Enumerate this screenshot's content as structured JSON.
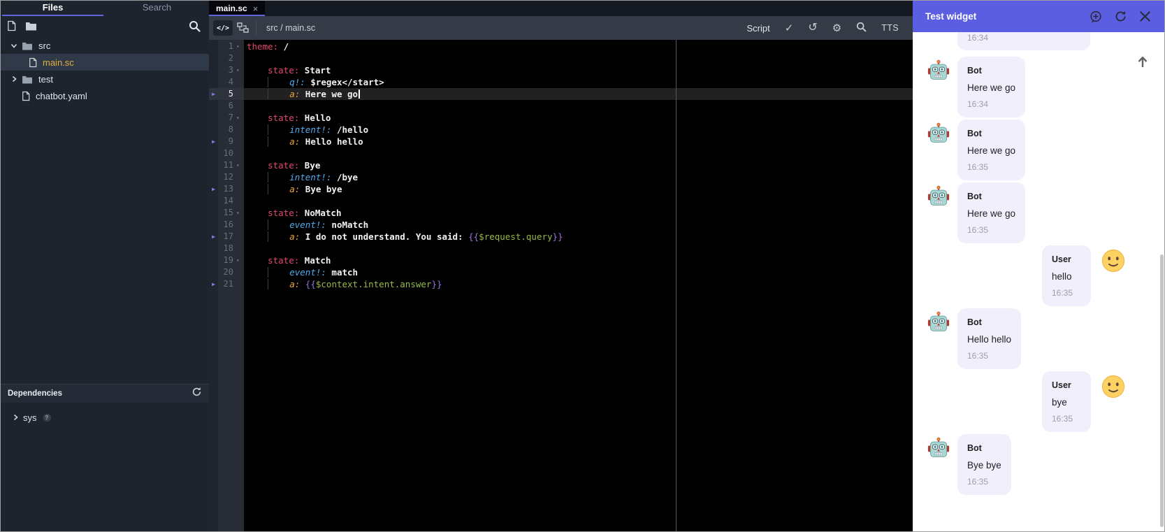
{
  "colors": {
    "accent": "#5f66e0",
    "chat-header": "#5b5ee1",
    "bubble": "#f1effb",
    "file-selected": "#e2b13c",
    "syn-key": "#e5486e",
    "syn-val": "#f2f2f2",
    "syn-q": "#53aef2",
    "syn-a": "#e8a33d",
    "syn-brace": "#9b6fe0",
    "syn-var": "#9aba46",
    "play": "#7b82e8"
  },
  "sidebar": {
    "tabs": [
      {
        "label": "Files",
        "active": true
      },
      {
        "label": "Search",
        "active": false
      }
    ],
    "tree": [
      {
        "kind": "folder",
        "label": "src",
        "expanded": true,
        "indent": 0,
        "selected": false
      },
      {
        "kind": "file",
        "label": "main.sc",
        "indent": 1,
        "selected": true
      },
      {
        "kind": "folder",
        "label": "test",
        "expanded": false,
        "indent": 0,
        "selected": false
      },
      {
        "kind": "file",
        "label": "chatbot.yaml",
        "indent": 0,
        "selected": false
      }
    ],
    "dependencies": {
      "title": "Dependencies",
      "items": [
        {
          "label": "sys"
        }
      ]
    }
  },
  "editor": {
    "tab_label": "main.sc",
    "tab_close": "×",
    "breadcrumb": "src / main.sc",
    "code_button": "</>",
    "mode_label": "Script",
    "check_glyph": "✓",
    "undo_glyph": "↺",
    "gear_glyph": "⚙",
    "tts_label": "TTS",
    "code": {
      "current_line": 5,
      "lines": [
        {
          "n": 1,
          "fold": true,
          "segs": [
            [
              "k",
              "theme:"
            ],
            [
              "v",
              " /"
            ]
          ]
        },
        {
          "n": 2,
          "segs": []
        },
        {
          "n": 3,
          "fold": true,
          "segs": [
            [
              "p",
              "    "
            ],
            [
              "k",
              "state:"
            ],
            [
              "v",
              " Start"
            ]
          ]
        },
        {
          "n": 4,
          "segs": [
            [
              "p",
              "    "
            ],
            [
              "gd",
              "    "
            ],
            [
              "q",
              "q!:"
            ],
            [
              "v",
              " $regex</start>"
            ]
          ]
        },
        {
          "n": 5,
          "play": true,
          "caret": true,
          "segs": [
            [
              "p",
              "    "
            ],
            [
              "gd",
              "    "
            ],
            [
              "a",
              "a:"
            ],
            [
              "v",
              " Here we go"
            ]
          ]
        },
        {
          "n": 6,
          "segs": []
        },
        {
          "n": 7,
          "fold": true,
          "segs": [
            [
              "p",
              "    "
            ],
            [
              "k",
              "state:"
            ],
            [
              "v",
              " Hello"
            ]
          ]
        },
        {
          "n": 8,
          "segs": [
            [
              "p",
              "    "
            ],
            [
              "gd",
              "    "
            ],
            [
              "q",
              "intent!:"
            ],
            [
              "v",
              " /hello"
            ]
          ]
        },
        {
          "n": 9,
          "play": true,
          "segs": [
            [
              "p",
              "    "
            ],
            [
              "gd",
              "    "
            ],
            [
              "a",
              "a:"
            ],
            [
              "v",
              " Hello hello"
            ]
          ]
        },
        {
          "n": 10,
          "segs": []
        },
        {
          "n": 11,
          "fold": true,
          "segs": [
            [
              "p",
              "    "
            ],
            [
              "k",
              "state:"
            ],
            [
              "v",
              " Bye"
            ]
          ]
        },
        {
          "n": 12,
          "segs": [
            [
              "p",
              "    "
            ],
            [
              "gd",
              "    "
            ],
            [
              "q",
              "intent!:"
            ],
            [
              "v",
              " /bye"
            ]
          ]
        },
        {
          "n": 13,
          "play": true,
          "segs": [
            [
              "p",
              "    "
            ],
            [
              "gd",
              "    "
            ],
            [
              "a",
              "a:"
            ],
            [
              "v",
              " Bye bye"
            ]
          ]
        },
        {
          "n": 14,
          "segs": []
        },
        {
          "n": 15,
          "fold": true,
          "segs": [
            [
              "p",
              "    "
            ],
            [
              "k",
              "state:"
            ],
            [
              "v",
              " NoMatch"
            ]
          ]
        },
        {
          "n": 16,
          "segs": [
            [
              "p",
              "    "
            ],
            [
              "gd",
              "    "
            ],
            [
              "q",
              "event!:"
            ],
            [
              "v",
              " noMatch"
            ]
          ]
        },
        {
          "n": 17,
          "play": true,
          "segs": [
            [
              "p",
              "    "
            ],
            [
              "gd",
              "    "
            ],
            [
              "a",
              "a:"
            ],
            [
              "v",
              " I do not understand. You said: "
            ],
            [
              "b",
              "{{"
            ],
            [
              "g",
              "$request.query"
            ],
            [
              "b",
              "}}"
            ]
          ]
        },
        {
          "n": 18,
          "segs": []
        },
        {
          "n": 19,
          "fold": true,
          "segs": [
            [
              "p",
              "    "
            ],
            [
              "k",
              "state:"
            ],
            [
              "v",
              " Match"
            ]
          ]
        },
        {
          "n": 20,
          "segs": [
            [
              "p",
              "    "
            ],
            [
              "gd",
              "    "
            ],
            [
              "q",
              "event!:"
            ],
            [
              "v",
              " match"
            ]
          ]
        },
        {
          "n": 21,
          "play": true,
          "segs": [
            [
              "p",
              "    "
            ],
            [
              "gd",
              "    "
            ],
            [
              "a",
              "a:"
            ],
            [
              "v",
              " "
            ],
            [
              "b",
              "{{"
            ],
            [
              "g",
              "$context.intent.answer"
            ],
            [
              "b",
              "}}"
            ]
          ]
        }
      ]
    }
  },
  "chat": {
    "title": "Test widget",
    "partial_message": {
      "time": "16:34"
    },
    "messages": [
      {
        "from": "bot",
        "name": "Bot",
        "avatar": "robot-emoji",
        "text": "Here we go",
        "time": "16:34"
      },
      {
        "from": "bot",
        "name": "Bot",
        "avatar": "robot-emoji",
        "text": "Here we go",
        "time": "16:35"
      },
      {
        "from": "bot",
        "name": "Bot",
        "avatar": "robot-emoji",
        "text": "Here we go",
        "time": "16:35"
      },
      {
        "from": "user",
        "name": "User",
        "avatar": "smiley-emoji",
        "text": "hello",
        "time": "16:35"
      },
      {
        "from": "bot",
        "name": "Bot",
        "avatar": "robot-emoji",
        "text": "Hello hello",
        "time": "16:35"
      },
      {
        "from": "user",
        "name": "User",
        "avatar": "smiley-emoji",
        "text": "bye",
        "time": "16:35"
      },
      {
        "from": "bot",
        "name": "Bot",
        "avatar": "robot-emoji",
        "text": "Bye bye",
        "time": "16:35"
      }
    ]
  }
}
